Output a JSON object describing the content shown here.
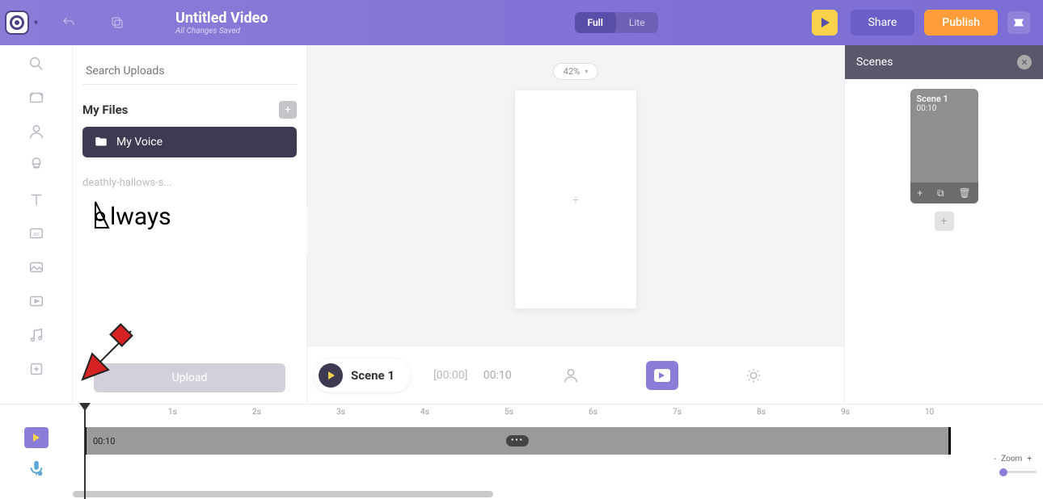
{
  "header": {
    "title": "Untitled Video",
    "subtitle": "All Changes Saved",
    "mode": {
      "full": "Full",
      "lite": "Lite",
      "active": "full"
    },
    "share": "Share",
    "publish": "Publish"
  },
  "uploads": {
    "search_placeholder": "Search Uploads",
    "my_files_label": "My Files",
    "selected_folder": "My Voice",
    "file_name": "deathly-hallows-s...",
    "thumb_text": "lways",
    "upload_label": "Upload"
  },
  "canvas": {
    "zoom": "42%"
  },
  "scene_bar": {
    "scene_label": "Scene 1",
    "current_time": "[00:00]",
    "duration": "00:10"
  },
  "scenes": {
    "title": "Scenes",
    "card": {
      "title": "Scene 1",
      "duration": "00:10"
    }
  },
  "timeline": {
    "ticks": [
      "1s",
      "2s",
      "3s",
      "4s",
      "5s",
      "6s",
      "7s",
      "8s",
      "9s",
      "10"
    ],
    "track_label": "00:10",
    "zoom_label": "Zoom"
  }
}
